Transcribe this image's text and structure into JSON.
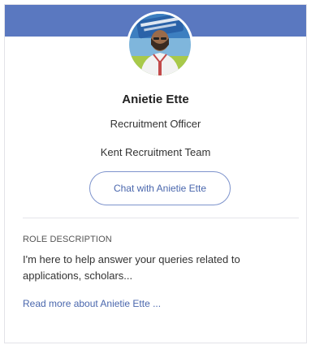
{
  "profile": {
    "name": "Anietie Ette",
    "role": "Recruitment Officer",
    "team": "Kent Recruitment Team",
    "chat_button_label": "Chat with Anietie Ette",
    "banner_color": "#5a78c0",
    "accent_color": "#4a67ad"
  },
  "role_section": {
    "label": "ROLE DESCRIPTION",
    "description": "I'm here to help answer your queries related to applications, scholars...",
    "read_more_label": "Read more about Anietie Ette ..."
  }
}
